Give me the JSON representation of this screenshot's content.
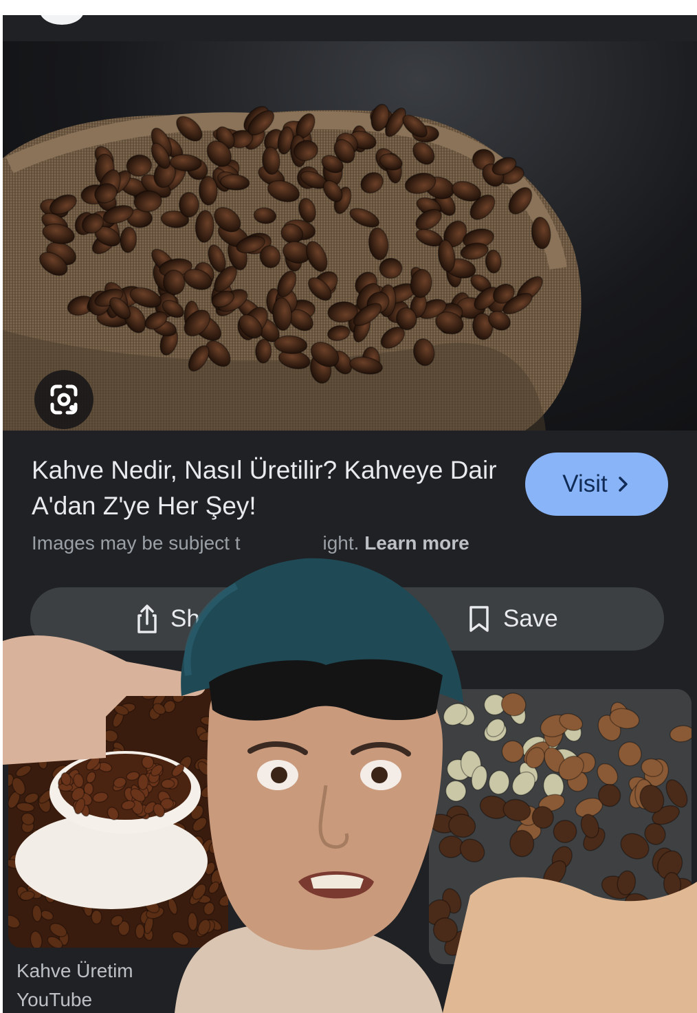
{
  "result": {
    "title": "Kahve Nedir, Nasıl Üretilir? Kahveye Dair A'dan Z'ye Her Şey!",
    "visit_label": "Visit",
    "copyright_prefix": "Images may be subject t",
    "copyright_suffix": "ight.",
    "learn_more": "Learn more"
  },
  "actions": {
    "share_label": "Sh",
    "save_label": "Save"
  },
  "related": {
    "title": "Kahve Üretim",
    "source": "YouTube"
  },
  "icons": [
    "google-lens-icon",
    "share-icon",
    "bookmark-icon",
    "chevron-right-icon"
  ],
  "colors": {
    "background": "#202124",
    "visit_button": "#8ab4f8",
    "action_bar": "#3c4043"
  }
}
